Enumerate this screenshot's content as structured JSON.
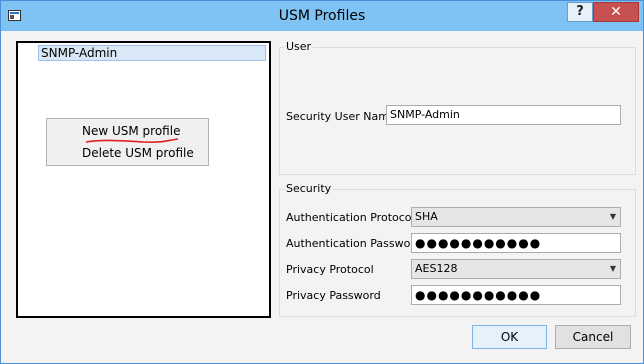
{
  "window": {
    "title": "USM Profiles",
    "help_label": "?",
    "close_label": "✕"
  },
  "profiles": {
    "items": [
      "SNMP-Admin"
    ]
  },
  "context_menu": {
    "items": [
      "New USM profile",
      "Delete USM profile"
    ]
  },
  "user_group": {
    "title": "User",
    "security_user_name_label": "Security User Name",
    "security_user_name_value": "SNMP-Admin"
  },
  "security_group": {
    "title": "Security",
    "auth_protocol_label": "Authentication Protocol",
    "auth_protocol_value": "SHA",
    "auth_password_label": "Authentication Password",
    "auth_password_value": "●●●●●●●●●●●",
    "privacy_protocol_label": "Privacy Protocol",
    "privacy_protocol_value": "AES128",
    "privacy_password_label": "Privacy Password",
    "privacy_password_value": "●●●●●●●●●●●"
  },
  "buttons": {
    "ok": "OK",
    "cancel": "Cancel"
  },
  "colors": {
    "titlebar": "#7ec3f4",
    "close": "#c75050",
    "annotation": "#e02020"
  }
}
